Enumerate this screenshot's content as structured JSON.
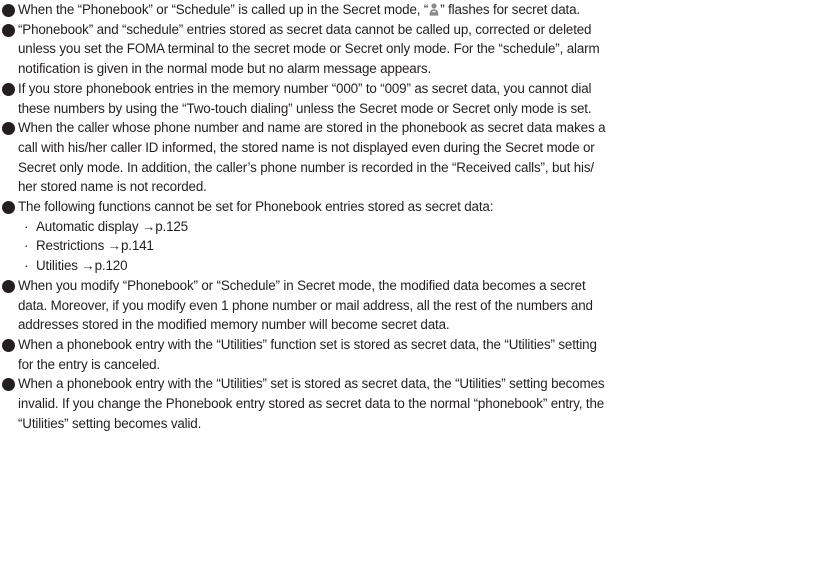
{
  "notes": {
    "n1_before": "When the “Phonebook” or “Schedule” is called up in the Secret mode, “",
    "n1_after": "” flashes for secret data.",
    "n2_l1": "“Phonebook” and “schedule” entries stored as secret data cannot be called up, corrected or deleted",
    "n2_l2": "unless you set the FOMA terminal to the secret mode or Secret only mode. For the “schedule”, alarm",
    "n2_l3": "notification is given in the normal mode but no alarm message appears.",
    "n3_l1": "If you store phonebook entries in the memory number “000” to “009” as secret data, you cannot dial",
    "n3_l2": "these numbers by using the “Two-touch dialing” unless the Secret mode or Secret only mode is set.",
    "n4_l1": "When the caller whose phone number and name are stored in the phonebook as secret data makes a",
    "n4_l2": "call with his/her caller ID informed, the stored name is not displayed even during the Secret mode or",
    "n4_l3": "Secret only mode. In addition, the caller’s phone number is recorded in the “Received calls”, but his/",
    "n4_l4": "her stored name is not recorded.",
    "n5_l1": "The following functions cannot be set for Phonebook entries stored as secret data:",
    "n5_sub": [
      "Automatic display →p.125",
      "Restrictions →p.141",
      "Utilities →p.120"
    ],
    "sub_marker": "·",
    "n6_l1": "When you modify “Phonebook” or “Schedule” in Secret mode, the modified data becomes a secret",
    "n6_l2": "data. Moreover, if you modify even 1 phone number or mail address, all the rest of the numbers and",
    "n6_l3": "addresses stored in the modified memory number will become secret data.",
    "n7_l1": "When a phonebook entry with the “Utilities” function set is stored as secret data, the “Utilities” setting",
    "n7_l2": "for the entry is canceled.",
    "n8_l1": "When a phonebook entry with the “Utilities” set is stored as secret data, the “Utilities” setting becomes",
    "n8_l2": "invalid. If you change the Phonebook entry stored as secret data to the normal “phonebook” entry, the",
    "n8_l3": "“Utilities” setting becomes valid."
  },
  "icons": {
    "bullet": "filled-circle-bullet",
    "secret": "secret-person-icon"
  },
  "colors": {
    "text": "#231f20",
    "secret_icon": "#8a8c8e"
  }
}
